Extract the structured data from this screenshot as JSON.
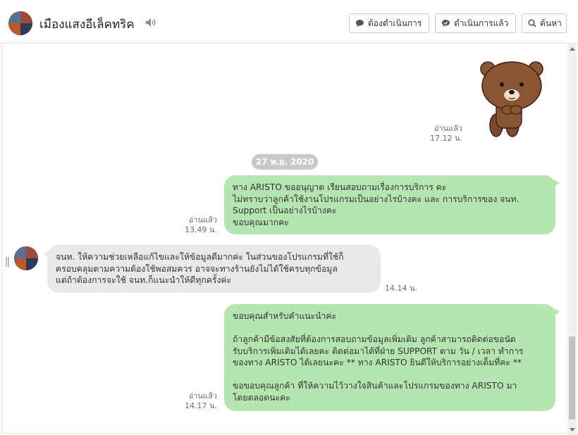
{
  "header": {
    "title": "เมืองแสงอีเล็คทริค",
    "buttons": {
      "pending": "ต้องดำเนินการ",
      "done": "ดำเนินการแล้ว",
      "search": "ค้นหา"
    }
  },
  "chat": {
    "sticker_meta": {
      "status": "อ่านแล้ว",
      "time": "17.12 น."
    },
    "date_separator": "27 พ.ย. 2020",
    "messages": [
      {
        "side": "out",
        "lines": [
          "ทาง ARISTO ขออนุญาต เรียนสอบถามเรื่องการบริการ คะ",
          "ไม่ทราบว่าลูกค้าใช้งานโปรแกรมเป็นอย่างไรบ้างคะ และ การบริการของ จนท.",
          "Support เป็นอย่างไรบ้างคะ",
          "ขอบคุณมากคะ"
        ],
        "status": "อ่านแล้ว",
        "time": "13.49 น."
      },
      {
        "side": "in",
        "lines": [
          "จนท. ให้ความช่วยเหลือแก้ไขและให้ข้อมูลดีมากค่ะ ในส่วนของโปรแกรมที่ใช้ก็",
          "ครอบคลุมตามความต้องใช้พอสมควร อาจจะทางร้านยังไม่ได้ใช้ครบทุกข้อมูล",
          "แต่ถ้าต้องการจะใช้ จนท.ก็แนะนำให้ดีทุกครั้งค่ะ"
        ],
        "time": "14.14 น."
      },
      {
        "side": "out",
        "lines": [
          "ขอบคุณสำหรับคำแนะนำค่ะ",
          "",
          "ถ้าลูกค้ามีข้อสงสัยที่ต้องการสอบถามข้อมูลเพิ่มเติม ลูกค้าสามารถติดต่อขอนัด",
          "รับบริการเพิ่มเติมได้เลยคะ ติดต่อมาได้ที่ฝ่าย SUPPORT ตาม วัน / เวลา ทำการ",
          "ของทาง ARISTO ได้เลยนะคะ ** ทาง ARISTO ยินดีให้บริการอย่างเต็มที่คะ **",
          "",
          "ขอขอบคุณลูกค้า ที่ให้ความไว้วางใจสินค้าและโปรแกรมของทาง ARISTO มา",
          "โดยตลอดนะคะ"
        ],
        "status": "อ่านแล้ว",
        "time": "14.17 น."
      }
    ]
  },
  "icons": {
    "speaker": "speaker-icon",
    "pending": "chat-bubble-icon",
    "done": "chat-check-icon",
    "search": "search-icon"
  },
  "colors": {
    "outgoing_bubble": "#b5e5b0",
    "incoming_bubble": "#e9e9ec",
    "date_pill": "#c9c9c9"
  }
}
